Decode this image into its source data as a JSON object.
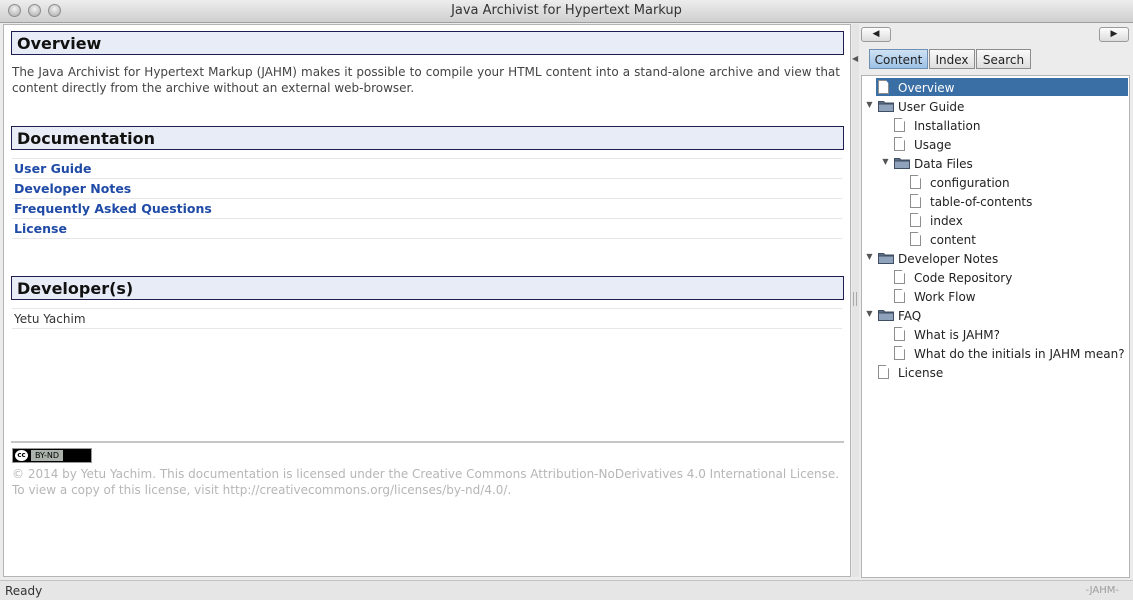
{
  "window": {
    "title": "Java Archivist for Hypertext Markup"
  },
  "sections": {
    "overview": {
      "heading": "Overview",
      "text": "The Java Archivist for Hypertext Markup (JAHM) makes it possible to compile your HTML content into a stand-alone archive and view that content directly from the archive without an external web-browser."
    },
    "documentation": {
      "heading": "Documentation",
      "links": [
        "User Guide",
        "Developer Notes",
        "Frequently Asked Questions",
        "License"
      ]
    },
    "developers": {
      "heading": "Developer(s)",
      "names": [
        "Yetu Yachim"
      ]
    }
  },
  "footer": {
    "badge": {
      "cc": "cc",
      "label": "BY-ND"
    },
    "license_text": "© 2014 by Yetu Yachim. This documentation is licensed under the Creative Commons Attribution-NoDerivatives 4.0 International License. To view a copy of this license, visit http://creativecommons.org/licenses/by-nd/4.0/."
  },
  "navigation": {
    "back": "◀",
    "forward": "▶"
  },
  "tabs": [
    "Content",
    "Index",
    "Search"
  ],
  "active_tab": "Content",
  "tree": [
    {
      "label": "Overview",
      "type": "doc",
      "selected": true
    },
    {
      "label": "User Guide",
      "type": "folder",
      "expanded": true
    },
    {
      "label": "Installation",
      "type": "doc"
    },
    {
      "label": "Usage",
      "type": "doc"
    },
    {
      "label": "Data Files",
      "type": "folder",
      "expanded": true
    },
    {
      "label": "configuration",
      "type": "doc"
    },
    {
      "label": "table-of-contents",
      "type": "doc"
    },
    {
      "label": "index",
      "type": "doc"
    },
    {
      "label": "content",
      "type": "doc"
    },
    {
      "label": "Developer Notes",
      "type": "folder",
      "expanded": true
    },
    {
      "label": "Code Repository",
      "type": "doc"
    },
    {
      "label": "Work Flow",
      "type": "doc"
    },
    {
      "label": "FAQ",
      "type": "folder",
      "expanded": true
    },
    {
      "label": "What is JAHM?",
      "type": "doc"
    },
    {
      "label": "What do the initials in JAHM mean?",
      "type": "doc"
    },
    {
      "label": "License",
      "type": "doc"
    }
  ],
  "status": {
    "left": "Ready",
    "right": "-JAHM-"
  },
  "colors": {
    "link": "#1f4aa6",
    "selection": "#3a6fa6",
    "header_border": "#1d1d4f",
    "header_fill": "#e8ecf6"
  }
}
